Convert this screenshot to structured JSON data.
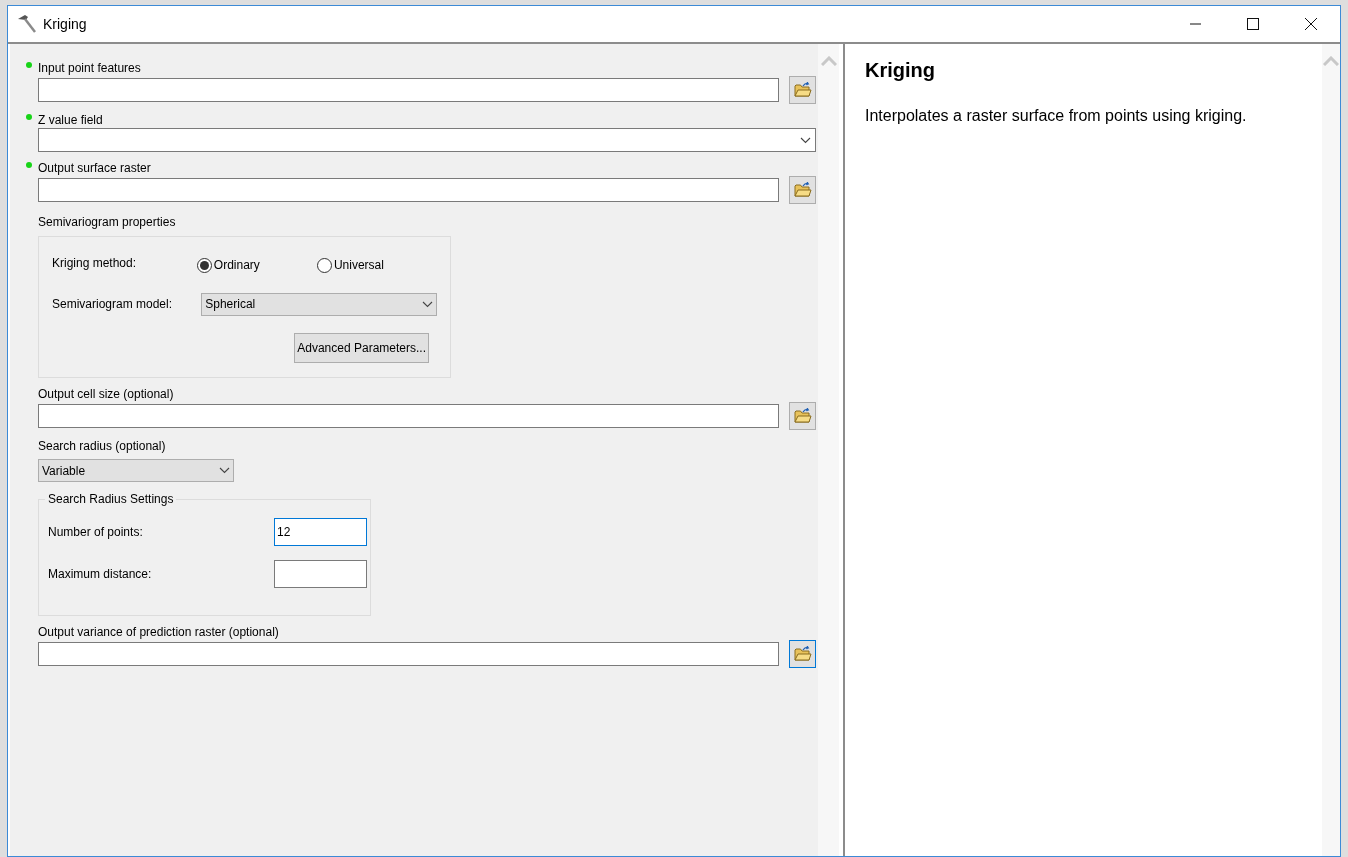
{
  "window": {
    "title": "Kriging"
  },
  "parameters": [
    {
      "kind": "browse",
      "label": "Input point features",
      "required": true,
      "focused": false
    },
    {
      "kind": "dropdown",
      "label": "Z value field",
      "required": true
    },
    {
      "kind": "browse",
      "label": "Output surface raster",
      "required": true,
      "focused": false
    },
    {
      "kind": "semivariogram",
      "label": "Semivariogram properties",
      "required": false,
      "method_label": "Kriging method:",
      "methods": [
        {
          "label": "Ordinary",
          "selected": true
        },
        {
          "label": "Universal",
          "selected": false
        }
      ],
      "model_label": "Semivariogram model:",
      "model": "Spherical",
      "button": "Advanced Parameters..."
    },
    {
      "kind": "browse",
      "label": "Output cell size (optional)",
      "required": false,
      "focused": false
    },
    {
      "kind": "search_radius",
      "label": "Search radius (optional)",
      "required": false,
      "value": "Variable",
      "settings": {
        "title": "Search Radius Settings",
        "fields": [
          {
            "label": "Number of points:",
            "value": "12",
            "focused": true
          },
          {
            "label": "Maximum distance:",
            "focused": false
          }
        ]
      }
    },
    {
      "kind": "browse",
      "label": "Output variance of prediction raster (optional)",
      "required": false,
      "focused": true
    }
  ],
  "help": {
    "title": "Kriging",
    "text": "Interpolates a raster surface from points using kriging."
  }
}
